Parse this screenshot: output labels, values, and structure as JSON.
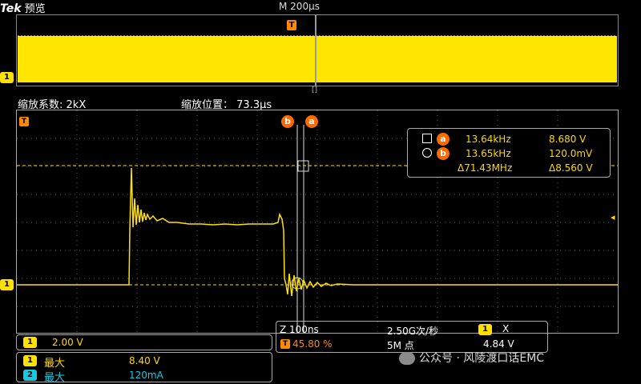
{
  "header": {
    "brand": "Tek",
    "mode": "预览",
    "timebase": "M 200µs"
  },
  "markers": {
    "trigger": "T",
    "ch1": "1",
    "ch2": "2",
    "cursor_a": "a",
    "cursor_b": "b",
    "zoom_cursor_symbol": "[]",
    "ref_arrow": "◂"
  },
  "zoom": {
    "factor_label": "缩放系数:",
    "factor": "2kX",
    "position_label": "缩放位置：",
    "position": "73.3µs"
  },
  "measurements": {
    "rows": [
      {
        "tag": "a",
        "freq": "13.64kHz",
        "value": "8.680 V"
      },
      {
        "tag": "b",
        "freq": "13.65kHz",
        "value": "120.0mV"
      }
    ],
    "delta_freq": "Δ71.43MHz",
    "delta_value": "Δ8.560 V"
  },
  "ch1_scale": "2.00 V",
  "stats": [
    {
      "channel": "1",
      "label": "最大",
      "value": "8.40 V"
    },
    {
      "channel": "2",
      "label": "最大",
      "value": "120mA"
    }
  ],
  "acq": {
    "zoom_scale": "Z 100ns",
    "sample_rate": "2.50G次/秒",
    "trigger_position": "45.80 %",
    "record_length": "5M 点",
    "trigger_channel": "1",
    "trigger_slope": "X",
    "trigger_level": "4.84 V"
  },
  "watermark": "公众号 · 风陵渡口话EMC",
  "colors": {
    "ch1": "#ffe000",
    "ch2": "#18c8e0",
    "cursor": "#ff6a00",
    "trigger": "#ff8a00"
  }
}
